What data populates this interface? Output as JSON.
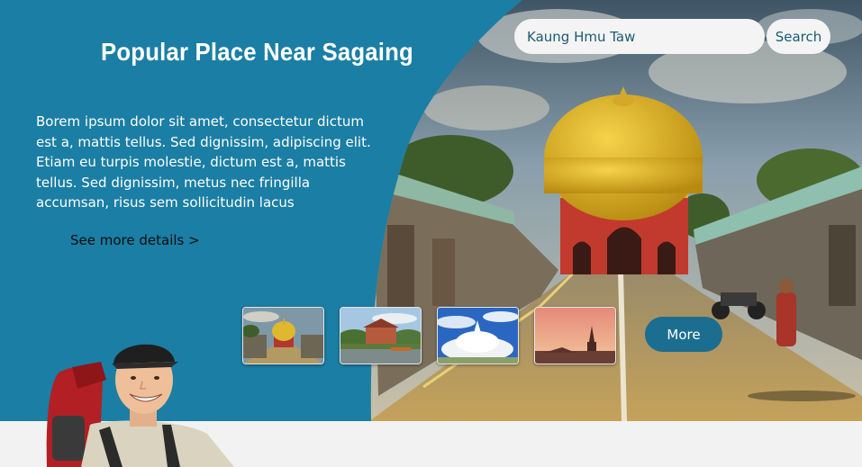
{
  "hero": {
    "title": "Popular Place Near Sagaing",
    "description": "Borem ipsum dolor sit amet, consectetur dictum est a, mattis tellus. Sed dignissim, adipiscing elit. Etiam eu turpis molestie, dictum est a, mattis tellus. Sed dignissim, metus nec fringilla accumsan, risus sem sollicitudin lacus",
    "details_link": "See more details >"
  },
  "search": {
    "value": "Kaung Hmu Taw",
    "button_label": "Search"
  },
  "gallery": {
    "thumbnails": [
      {
        "name": "golden-pagoda-street"
      },
      {
        "name": "river-building"
      },
      {
        "name": "white-pagoda"
      },
      {
        "name": "sunset-pagoda"
      }
    ],
    "more_label": "More"
  },
  "colors": {
    "primary": "#1b7ea4",
    "button": "#1b6e90",
    "background": "#f2f2f2"
  }
}
